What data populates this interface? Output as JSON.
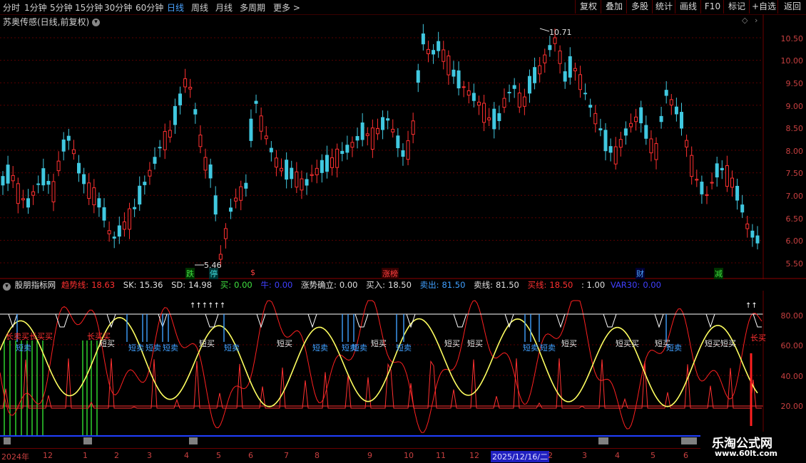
{
  "toolbar": {
    "timeframes": [
      "分时",
      "1分钟",
      "5分钟",
      "15分钟",
      "30分钟",
      "60分钟",
      "日线",
      "周线",
      "月线",
      "多周期",
      "更多"
    ],
    "active_timeframe": "日线",
    "more_arrow": ">",
    "buttons": [
      "复权",
      "叠加",
      "多股",
      "统计",
      "画线",
      "F10",
      "标记",
      "+自选",
      "返回"
    ]
  },
  "main_chart": {
    "title": "苏奥传感(日线,前复权)",
    "high_label": "10.71",
    "low_label": "5.46",
    "price_axis": [
      "10.50",
      "10.00",
      "9.50",
      "9.00",
      "8.50",
      "8.00",
      "7.50",
      "7.00",
      "6.50",
      "6.00",
      "5.50"
    ],
    "markers": [
      {
        "text": "跌",
        "color": "#40e040",
        "bg": "#003300"
      },
      {
        "text": "停",
        "color": "#40e0e0",
        "bg": "#003333"
      },
      {
        "text": "$",
        "color": "#ff4040",
        "bg": "#000000"
      },
      {
        "text": "涨榜",
        "color": "#ff4040",
        "bg": "#330000"
      },
      {
        "text": "财",
        "color": "#4aa3ff",
        "bg": "#000033"
      },
      {
        "text": "减",
        "color": "#40e040",
        "bg": "#003300"
      }
    ]
  },
  "indicator": {
    "name": "股朋指标网",
    "items": [
      {
        "label": "趋势线:",
        "value": "18.63",
        "color": "#ff3030"
      },
      {
        "label": "SK:",
        "value": "15.36",
        "color": "#e0e0e0"
      },
      {
        "label": "SD:",
        "value": "14.98",
        "color": "#e0e0e0"
      },
      {
        "label": "买:",
        "value": "0.00",
        "color": "#40e040"
      },
      {
        "label": "牛:",
        "value": "0.00",
        "color": "#4040ff"
      },
      {
        "label": "涨势确立:",
        "value": "0.00",
        "color": "#e0e0e0"
      },
      {
        "label": "买入:",
        "value": "18.50",
        "color": "#e0e0e0"
      },
      {
        "label": "卖出:",
        "value": "81.50",
        "color": "#40a0ff"
      },
      {
        "label": "卖线:",
        "value": "81.50",
        "color": "#e0e0e0"
      },
      {
        "label": "买线:",
        "value": "18.50",
        "color": "#ff3030"
      },
      {
        "label": "",
        "value": ": 1.00",
        "color": "#e0e0e0"
      },
      {
        "label": "VAR30:",
        "value": "0.00",
        "color": "#4040ff"
      }
    ],
    "axis": [
      "80.00",
      "60.00",
      "40.00",
      "20.00"
    ],
    "tags": {
      "short_buy": "短买",
      "short_sell": "短卖",
      "long_buy": "长买",
      "long_sell_group": "长卖买长买买",
      "long_buy_left": "长买买",
      "combo_short": "短买买",
      "combo_ss": "短卖短卖",
      "combo_sb": "短卖短卖"
    }
  },
  "x_axis": {
    "labels": [
      "2024年",
      "12",
      "1",
      "2",
      "3",
      "4",
      "5",
      "6",
      "7",
      "8",
      "9",
      "10",
      "11",
      "12",
      "2025/12/16/二",
      "2",
      "3",
      "4",
      "5",
      "6"
    ]
  },
  "watermark": {
    "line1": "乐淘公式网",
    "line2": "www.60lt.com"
  },
  "colors": {
    "up": "#ff3030",
    "down": "#40c8e0",
    "grid": "#5a0000",
    "yellow": "#ffff60",
    "white": "#ffffff",
    "green": "#30e030"
  }
}
